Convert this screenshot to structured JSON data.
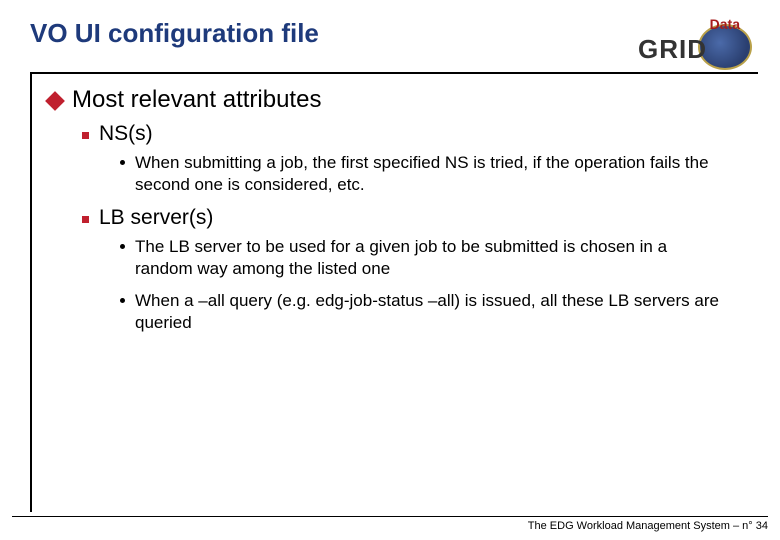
{
  "title": "VO UI configuration file",
  "logo": {
    "data": "Data",
    "grid": "GRID"
  },
  "l1": "Most relevant attributes",
  "sections": [
    {
      "heading": "NS(s)",
      "bullets": [
        "When submitting a job, the first specified NS is tried, if the operation fails the second one is considered, etc."
      ]
    },
    {
      "heading": "LB server(s)",
      "bullets": [
        "The LB server to be used for a given job to be submitted is chosen in a random way among the listed one",
        "When a –all query (e.g. edg-job-status –all) is issued, all these LB servers are queried"
      ]
    }
  ],
  "footer": {
    "text": "The EDG Workload Management System –  n°",
    "page": "34"
  }
}
